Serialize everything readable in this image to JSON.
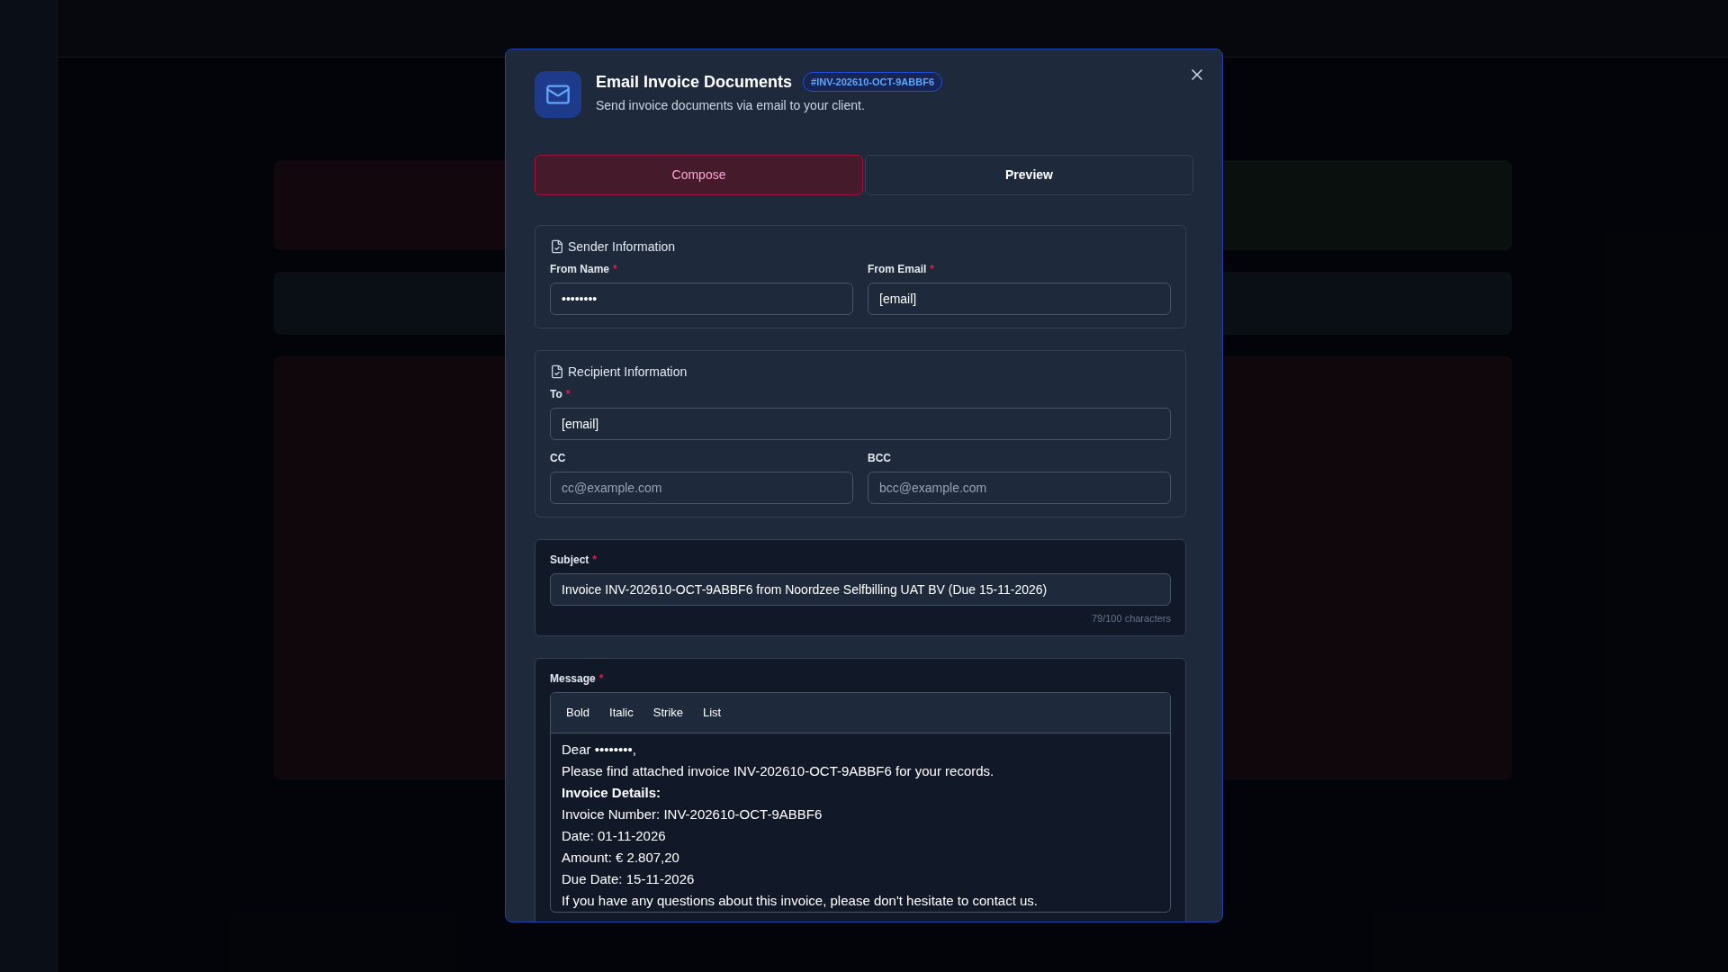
{
  "dialog": {
    "title": "Email Invoice Documents",
    "badge": "#INV-202610-OCT-9ABBF6",
    "subtitle": "Send invoice documents via email to your client.",
    "required_mark": "*",
    "tabs": [
      {
        "label": "Compose",
        "selected": true
      },
      {
        "label": "Preview",
        "selected": false
      }
    ],
    "sender": {
      "title": "Sender Information",
      "fields": [
        {
          "label": "From Name",
          "required": true,
          "value": "••••••••"
        },
        {
          "label": "From Email",
          "required": true,
          "value": "[email]"
        }
      ]
    },
    "recipient": {
      "title": "Recipient Information",
      "to": {
        "label": "To",
        "required": true,
        "value": "[email]"
      },
      "fields": [
        {
          "label": "CC",
          "required": false,
          "placeholder": "cc@example.com"
        },
        {
          "label": "BCC",
          "required": false,
          "placeholder": "bcc@example.com"
        }
      ]
    },
    "subject": {
      "label": "Subject",
      "required": true,
      "value": "Invoice INV-202610-OCT-9ABBF6 from Noordzee Selfbilling UAT BV (Due 15-11-2026)",
      "counter": "79/100 characters"
    },
    "message": {
      "label": "Message",
      "required": true,
      "toolbar": [
        "Bold",
        "Italic",
        "Strike",
        "List"
      ],
      "lines": [
        {
          "kind": "text",
          "text": "Dear ••••••••,"
        },
        {
          "kind": "text",
          "text": "Please find attached invoice INV-202610-OCT-9ABBF6 for your records."
        },
        {
          "kind": "heading",
          "text": "Invoice Details:"
        },
        {
          "kind": "text",
          "text": "Invoice Number: INV-202610-OCT-9ABBF6"
        },
        {
          "kind": "text",
          "text": "Date: 01-11-2026"
        },
        {
          "kind": "text",
          "text": "Amount: € 2.807,20"
        },
        {
          "kind": "text",
          "text": "Due Date: 15-11-2026"
        },
        {
          "kind": "text",
          "text": "If you have any questions about this invoice, please don't hesitate to contact us."
        }
      ]
    }
  }
}
